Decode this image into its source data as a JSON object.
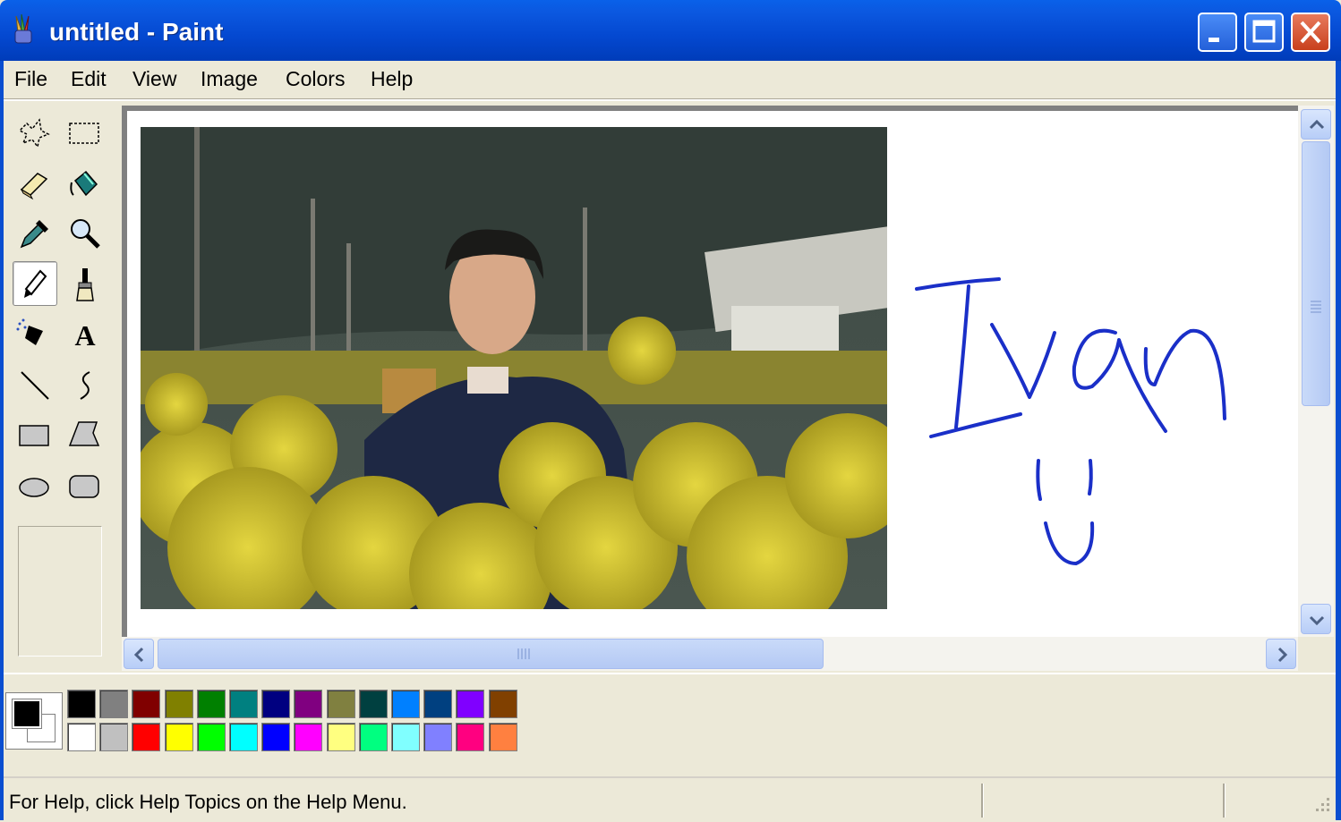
{
  "window": {
    "title": "untitled - Paint",
    "app_icon": "paint-icon"
  },
  "window_buttons": {
    "minimize": "minimize-icon",
    "maximize": "maximize-icon",
    "close": "close-icon"
  },
  "menu": [
    {
      "label": "File"
    },
    {
      "label": "Edit"
    },
    {
      "label": "View"
    },
    {
      "label": "Image"
    },
    {
      "label": "Colors"
    },
    {
      "label": "Help"
    }
  ],
  "tools": [
    {
      "name": "free-form-select",
      "icon": "free-select-icon"
    },
    {
      "name": "select",
      "icon": "rect-select-icon"
    },
    {
      "name": "eraser",
      "icon": "eraser-icon"
    },
    {
      "name": "fill-with-color",
      "icon": "paint-bucket-icon"
    },
    {
      "name": "pick-color",
      "icon": "eyedropper-icon"
    },
    {
      "name": "magnifier",
      "icon": "magnifier-icon"
    },
    {
      "name": "pencil",
      "icon": "pencil-icon",
      "selected": true
    },
    {
      "name": "brush",
      "icon": "brush-icon"
    },
    {
      "name": "airbrush",
      "icon": "airbrush-icon"
    },
    {
      "name": "text",
      "icon": "text-icon",
      "glyph": "A"
    },
    {
      "name": "line",
      "icon": "line-icon"
    },
    {
      "name": "curve",
      "icon": "curve-icon"
    },
    {
      "name": "rectangle",
      "icon": "rectangle-icon"
    },
    {
      "name": "polygon",
      "icon": "polygon-icon"
    },
    {
      "name": "ellipse",
      "icon": "ellipse-icon"
    },
    {
      "name": "rounded-rectangle",
      "icon": "rounded-rect-icon"
    }
  ],
  "canvas": {
    "handwriting": "Ivan",
    "handwriting_color": "#1a2fc8"
  },
  "colors": {
    "foreground": "#000000",
    "background": "#ffffff",
    "palette_top": [
      "#000000",
      "#808080",
      "#800000",
      "#808000",
      "#008000",
      "#008080",
      "#000080",
      "#800080",
      "#808040",
      "#004040",
      "#0080ff",
      "#004080",
      "#8000ff",
      "#804000"
    ],
    "palette_bottom": [
      "#ffffff",
      "#c0c0c0",
      "#ff0000",
      "#ffff00",
      "#00ff00",
      "#00ffff",
      "#0000ff",
      "#ff00ff",
      "#ffff80",
      "#00ff80",
      "#80ffff",
      "#8080ff",
      "#ff0080",
      "#ff8040"
    ]
  },
  "status": {
    "text": "For Help, click Help Topics on the Help Menu."
  }
}
